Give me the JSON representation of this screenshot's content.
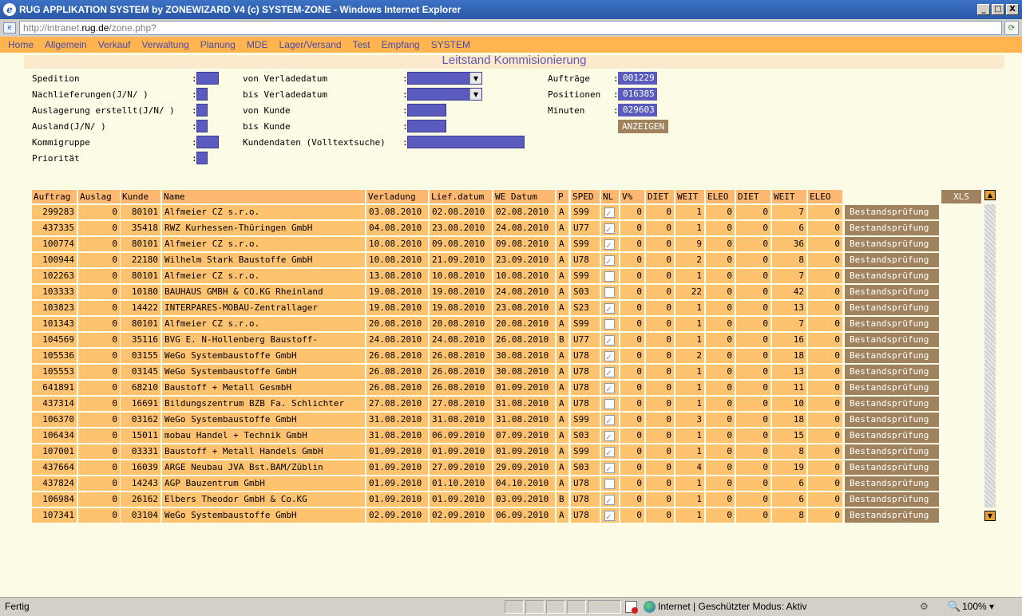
{
  "window": {
    "title": "RUG APPLIKATION SYSTEM by ZONEWIZARD V4 (c) SYSTEM-ZONE - Windows Internet Explorer",
    "min": "_",
    "max": "□",
    "close": "X"
  },
  "address": {
    "prefix": "http://intranet.",
    "host": "rug.de",
    "path": "/zone.php?"
  },
  "menu": [
    "Home",
    "Allgemein",
    "Verkauf",
    "Verwaltung",
    "Planung",
    "MDE",
    "Lager/Versand",
    "Test",
    "Empfang",
    "SYSTEM"
  ],
  "page_title": "Leitstand Kommisionierung",
  "filters_left": [
    "Spedition",
    "Nachlieferungen(J/N/ )",
    "Auslagerung erstellt(J/N/ )",
    "Ausland(J/N/ )",
    "Kommigruppe",
    "Priorität"
  ],
  "filters_mid": [
    "von Verladedatum",
    "bis Verladedatum",
    "von Kunde",
    "bis Kunde",
    "Kundendaten (Volltextsuche)"
  ],
  "colon": ":",
  "stats": {
    "auftraege_label": "Aufträge",
    "auftraege": "001229",
    "positionen_label": "Positionen",
    "positionen": "016385",
    "minuten_label": "Minuten",
    "minuten": "029603",
    "anzeigen": "ANZEIGEN"
  },
  "xls": "XLS",
  "columns": [
    "Auftrag",
    "Auslag",
    "Kunde",
    "Name",
    "Verladung",
    "Lief.datum",
    "WE Datum",
    "P",
    "SPED",
    "NL",
    "V%",
    "DIET",
    "WEIT",
    "ELEO",
    "DIET",
    "WEIT",
    "ELEO"
  ],
  "check_button": "Bestandsprüfung",
  "rows": [
    {
      "auftrag": "299283",
      "auslag": "0",
      "kunde": "80101",
      "name": "Alfmeier CZ s.r.o.",
      "verladung": "03.08.2010",
      "lief": "02.08.2010",
      "we": "02.08.2010",
      "p": "A",
      "sped": "S99",
      "nl": true,
      "v": "0",
      "diet1": "0",
      "weit1": "1",
      "eleo1": "0",
      "diet2": "0",
      "weit2": "7",
      "eleo2": "0"
    },
    {
      "auftrag": "437335",
      "auslag": "0",
      "kunde": "35418",
      "name": "RWZ Kurhessen-Thüringen GmbH",
      "verladung": "04.08.2010",
      "lief": "23.08.2010",
      "we": "24.08.2010",
      "p": "A",
      "sped": "U77",
      "nl": true,
      "v": "0",
      "diet1": "0",
      "weit1": "1",
      "eleo1": "0",
      "diet2": "0",
      "weit2": "6",
      "eleo2": "0"
    },
    {
      "auftrag": "100774",
      "auslag": "0",
      "kunde": "80101",
      "name": "Alfmeier CZ s.r.o.",
      "verladung": "10.08.2010",
      "lief": "09.08.2010",
      "we": "09.08.2010",
      "p": "A",
      "sped": "S99",
      "nl": true,
      "v": "0",
      "diet1": "0",
      "weit1": "9",
      "eleo1": "0",
      "diet2": "0",
      "weit2": "36",
      "eleo2": "0"
    },
    {
      "auftrag": "100944",
      "auslag": "0",
      "kunde": "22180",
      "name": "Wilhelm Stark Baustoffe GmbH",
      "verladung": "10.08.2010",
      "lief": "21.09.2010",
      "we": "23.09.2010",
      "p": "A",
      "sped": "U78",
      "nl": true,
      "v": "0",
      "diet1": "0",
      "weit1": "2",
      "eleo1": "0",
      "diet2": "0",
      "weit2": "8",
      "eleo2": "0"
    },
    {
      "auftrag": "102263",
      "auslag": "0",
      "kunde": "80101",
      "name": "Alfmeier CZ s.r.o.",
      "verladung": "13.08.2010",
      "lief": "10.08.2010",
      "we": "10.08.2010",
      "p": "A",
      "sped": "S99",
      "nl": false,
      "v": "0",
      "diet1": "0",
      "weit1": "1",
      "eleo1": "0",
      "diet2": "0",
      "weit2": "7",
      "eleo2": "0"
    },
    {
      "auftrag": "103333",
      "auslag": "0",
      "kunde": "10180",
      "name": "BAUHAUS GMBH & CO.KG Rheinland",
      "verladung": "19.08.2010",
      "lief": "19.08.2010",
      "we": "24.08.2010",
      "p": "A",
      "sped": "S03",
      "nl": false,
      "v": "0",
      "diet1": "0",
      "weit1": "22",
      "eleo1": "0",
      "diet2": "0",
      "weit2": "42",
      "eleo2": "0"
    },
    {
      "auftrag": "103823",
      "auslag": "0",
      "kunde": "14422",
      "name": "INTERPARES-MOBAU-Zentrallager",
      "verladung": "19.08.2010",
      "lief": "19.08.2010",
      "we": "23.08.2010",
      "p": "A",
      "sped": "S23",
      "nl": true,
      "v": "0",
      "diet1": "0",
      "weit1": "1",
      "eleo1": "0",
      "diet2": "0",
      "weit2": "13",
      "eleo2": "0"
    },
    {
      "auftrag": "101343",
      "auslag": "0",
      "kunde": "80101",
      "name": "Alfmeier CZ s.r.o.",
      "verladung": "20.08.2010",
      "lief": "20.08.2010",
      "we": "20.08.2010",
      "p": "A",
      "sped": "S99",
      "nl": false,
      "v": "0",
      "diet1": "0",
      "weit1": "1",
      "eleo1": "0",
      "diet2": "0",
      "weit2": "7",
      "eleo2": "0"
    },
    {
      "auftrag": "104569",
      "auslag": "0",
      "kunde": "35116",
      "name": "BVG E. N-Hollenberg Baustoff-",
      "verladung": "24.08.2010",
      "lief": "24.08.2010",
      "we": "26.08.2010",
      "p": "B",
      "sped": "U77",
      "nl": true,
      "v": "0",
      "diet1": "0",
      "weit1": "1",
      "eleo1": "0",
      "diet2": "0",
      "weit2": "16",
      "eleo2": "0"
    },
    {
      "auftrag": "105536",
      "auslag": "0",
      "kunde": "03155",
      "name": "WeGo Systembaustoffe GmbH",
      "verladung": "26.08.2010",
      "lief": "26.08.2010",
      "we": "30.08.2010",
      "p": "A",
      "sped": "U78",
      "nl": true,
      "v": "0",
      "diet1": "0",
      "weit1": "2",
      "eleo1": "0",
      "diet2": "0",
      "weit2": "18",
      "eleo2": "0"
    },
    {
      "auftrag": "105553",
      "auslag": "0",
      "kunde": "03145",
      "name": "WeGo Systembaustoffe GmbH",
      "verladung": "26.08.2010",
      "lief": "26.08.2010",
      "we": "30.08.2010",
      "p": "A",
      "sped": "U78",
      "nl": true,
      "v": "0",
      "diet1": "0",
      "weit1": "1",
      "eleo1": "0",
      "diet2": "0",
      "weit2": "13",
      "eleo2": "0"
    },
    {
      "auftrag": "641891",
      "auslag": "0",
      "kunde": "68210",
      "name": "Baustoff + Metall GesmbH",
      "verladung": "26.08.2010",
      "lief": "26.08.2010",
      "we": "01.09.2010",
      "p": "A",
      "sped": "U78",
      "nl": true,
      "v": "0",
      "diet1": "0",
      "weit1": "1",
      "eleo1": "0",
      "diet2": "0",
      "weit2": "11",
      "eleo2": "0"
    },
    {
      "auftrag": "437314",
      "auslag": "0",
      "kunde": "16691",
      "name": "Bildungszentrum BZB Fa. Schlichter",
      "verladung": "27.08.2010",
      "lief": "27.08.2010",
      "we": "31.08.2010",
      "p": "A",
      "sped": "U78",
      "nl": false,
      "v": "0",
      "diet1": "0",
      "weit1": "1",
      "eleo1": "0",
      "diet2": "0",
      "weit2": "10",
      "eleo2": "0"
    },
    {
      "auftrag": "106370",
      "auslag": "0",
      "kunde": "03162",
      "name": "WeGo Systembaustoffe GmbH",
      "verladung": "31.08.2010",
      "lief": "31.08.2010",
      "we": "31.08.2010",
      "p": "A",
      "sped": "S99",
      "nl": true,
      "v": "0",
      "diet1": "0",
      "weit1": "3",
      "eleo1": "0",
      "diet2": "0",
      "weit2": "18",
      "eleo2": "0"
    },
    {
      "auftrag": "106434",
      "auslag": "0",
      "kunde": "15011",
      "name": "mobau Handel + Technik GmbH",
      "verladung": "31.08.2010",
      "lief": "06.09.2010",
      "we": "07.09.2010",
      "p": "A",
      "sped": "S03",
      "nl": true,
      "v": "0",
      "diet1": "0",
      "weit1": "1",
      "eleo1": "0",
      "diet2": "0",
      "weit2": "15",
      "eleo2": "0"
    },
    {
      "auftrag": "107001",
      "auslag": "0",
      "kunde": "03331",
      "name": "Baustoff + Metall Handels GmbH",
      "verladung": "01.09.2010",
      "lief": "01.09.2010",
      "we": "01.09.2010",
      "p": "A",
      "sped": "S99",
      "nl": true,
      "v": "0",
      "diet1": "0",
      "weit1": "1",
      "eleo1": "0",
      "diet2": "0",
      "weit2": "8",
      "eleo2": "0"
    },
    {
      "auftrag": "437664",
      "auslag": "0",
      "kunde": "16039",
      "name": "ARGE Neubau JVA Bst.BAM/Züblin",
      "verladung": "01.09.2010",
      "lief": "27.09.2010",
      "we": "29.09.2010",
      "p": "A",
      "sped": "S03",
      "nl": true,
      "v": "0",
      "diet1": "0",
      "weit1": "4",
      "eleo1": "0",
      "diet2": "0",
      "weit2": "19",
      "eleo2": "0"
    },
    {
      "auftrag": "437824",
      "auslag": "0",
      "kunde": "14243",
      "name": "AGP Bauzentrum GmbH",
      "verladung": "01.09.2010",
      "lief": "01.10.2010",
      "we": "04.10.2010",
      "p": "A",
      "sped": "U78",
      "nl": false,
      "v": "0",
      "diet1": "0",
      "weit1": "1",
      "eleo1": "0",
      "diet2": "0",
      "weit2": "6",
      "eleo2": "0"
    },
    {
      "auftrag": "106984",
      "auslag": "0",
      "kunde": "26162",
      "name": "Elbers Theodor GmbH & Co.KG",
      "verladung": "01.09.2010",
      "lief": "01.09.2010",
      "we": "03.09.2010",
      "p": "B",
      "sped": "U78",
      "nl": true,
      "v": "0",
      "diet1": "0",
      "weit1": "1",
      "eleo1": "0",
      "diet2": "0",
      "weit2": "6",
      "eleo2": "0"
    },
    {
      "auftrag": "107341",
      "auslag": "0",
      "kunde": "03104",
      "name": "WeGo Systembaustoffe GmbH",
      "verladung": "02.09.2010",
      "lief": "02.09.2010",
      "we": "06.09.2010",
      "p": "A",
      "sped": "U78",
      "nl": true,
      "v": "0",
      "diet1": "0",
      "weit1": "1",
      "eleo1": "0",
      "diet2": "0",
      "weit2": "8",
      "eleo2": "0"
    }
  ],
  "status": {
    "text": "Fertig",
    "zone": "Internet | Geschützter Modus: Aktiv",
    "zoom": "100%",
    "zoom_arrow": "▾"
  },
  "colors": {
    "menubar": "#ffb450",
    "cell": "#ffc26e",
    "field": "#5b5bbe",
    "button": "#a0825e",
    "title": "#5b5bb0"
  }
}
